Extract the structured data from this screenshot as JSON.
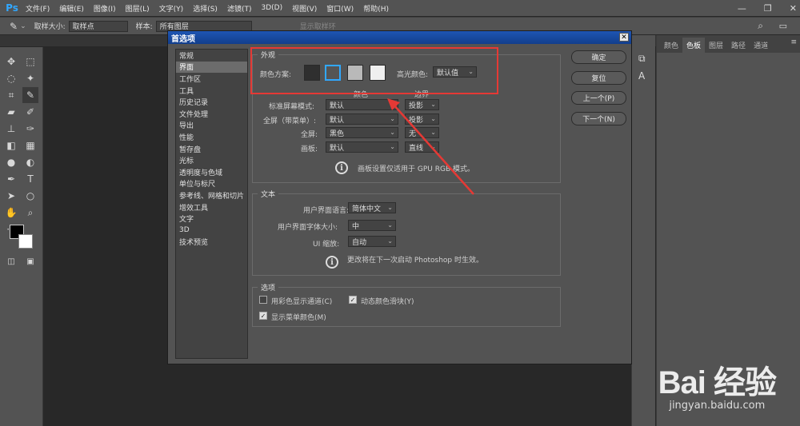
{
  "menubar": {
    "logo": "Ps",
    "items": [
      "文件(F)",
      "编辑(E)",
      "图像(I)",
      "图层(L)",
      "文字(Y)",
      "选择(S)",
      "滤镜(T)",
      "3D(D)",
      "视图(V)",
      "窗口(W)",
      "帮助(H)"
    ],
    "minimize": "—",
    "maximize": "❐",
    "close": "✕"
  },
  "options": {
    "sample_size_label": "取样大小:",
    "sample_size_value": "取样点",
    "sample_label": "样本:",
    "sample_value": "所有图层",
    "show_ring": "显示取样环"
  },
  "panel": {
    "tabs": [
      "颜色",
      "色板",
      "图层",
      "路径",
      "通道"
    ],
    "active_tab": "色板"
  },
  "dialog": {
    "title": "首选项",
    "close": "✕",
    "categories": [
      "常规",
      "界面",
      "工作区",
      "工具",
      "历史记录",
      "文件处理",
      "导出",
      "性能",
      "暂存盘",
      "光标",
      "透明度与色域",
      "单位与标尺",
      "参考线、网格和切片",
      "增效工具",
      "文字",
      "3D",
      "技术预览"
    ],
    "selected_category": "界面",
    "buttons": {
      "ok": "确定",
      "reset": "复位",
      "prev": "上一个(P)",
      "next": "下一个(N)"
    },
    "appearance": {
      "label": "外观",
      "color_scheme_label": "颜色方案:",
      "highlight_label": "高光颜色:",
      "highlight_value": "默认值",
      "swatch_colors": [
        "#2f2f2f",
        "#555555",
        "#b9b9b9",
        "#efefef"
      ],
      "col_color": "颜色",
      "col_border": "边界",
      "rows": [
        {
          "label": "标准屏幕模式:",
          "color": "默认",
          "border": "投影"
        },
        {
          "label": "全屏（带菜单）:",
          "color": "默认",
          "border": "投影"
        },
        {
          "label": "全屏:",
          "color": "黑色",
          "border": "无"
        },
        {
          "label": "画板:",
          "color": "默认",
          "border": "直线"
        }
      ],
      "note": "画板设置仅适用于 GPU RGB 模式。"
    },
    "text": {
      "label": "文本",
      "language_label": "用户界面语言:",
      "language_value": "简体中文",
      "font_size_label": "用户界面字体大小:",
      "font_size_value": "中",
      "scale_label": "UI 缩放:",
      "scale_value": "自动",
      "note": "更改将在下一次启动 Photoshop 时生效。"
    },
    "options": {
      "label": "选项",
      "chk1": "用彩色显示通道(C)",
      "chk1_on": false,
      "chk2": "动态颜色滑块(Y)",
      "chk2_on": true,
      "chk3": "显示菜单颜色(M)",
      "chk3_on": true
    }
  },
  "watermark": {
    "main": "Bai 经验",
    "sub": "jingyan.baidu.com"
  },
  "colors": {
    "highlight": "#e53935",
    "title_bar": "#1e55b3"
  }
}
